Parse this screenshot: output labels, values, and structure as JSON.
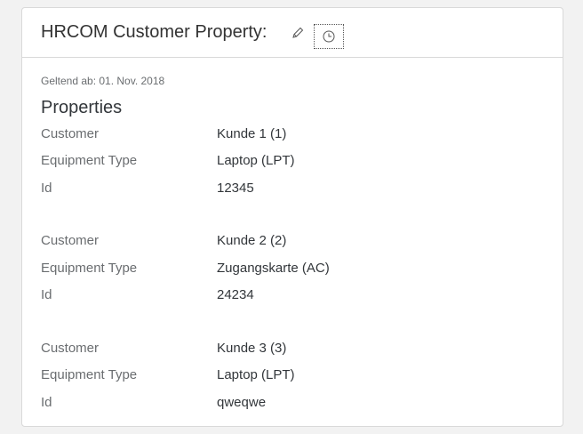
{
  "header": {
    "title": "HRCOM Customer Property:",
    "edit_icon": "pencil-icon",
    "history_icon": "clock-icon"
  },
  "body": {
    "valid_from": "Geltend ab: 01. Nov. 2018",
    "section_title": "Properties",
    "groups": [
      {
        "rows": [
          {
            "label": "Customer",
            "value": "Kunde 1 (1)"
          },
          {
            "label": "Equipment Type",
            "value": "Laptop (LPT)"
          },
          {
            "label": "Id",
            "value": "12345"
          }
        ]
      },
      {
        "rows": [
          {
            "label": "Customer",
            "value": "Kunde 2 (2)"
          },
          {
            "label": "Equipment Type",
            "value": "Zugangskarte (AC)"
          },
          {
            "label": "Id",
            "value": "24234"
          }
        ]
      },
      {
        "rows": [
          {
            "label": "Customer",
            "value": "Kunde 3 (3)"
          },
          {
            "label": "Equipment Type",
            "value": "Laptop (LPT)"
          },
          {
            "label": "Id",
            "value": "qweqwe"
          }
        ]
      }
    ]
  },
  "colors": {
    "label_text": "#6a6d70",
    "value_text": "#32363a",
    "border": "#d9d9d9"
  }
}
